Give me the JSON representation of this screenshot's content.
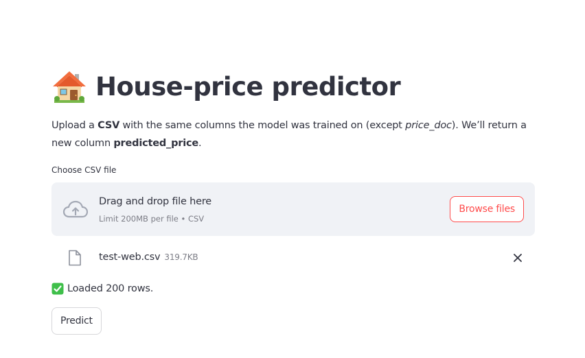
{
  "header": {
    "title": "House-price predictor",
    "icon": "house-icon"
  },
  "description": {
    "part1": "Upload a ",
    "bold1": "CSV",
    "part2": " with the same columns the model was trained on (except ",
    "italic1": "price_doc",
    "part3": "). We’ll return a new column ",
    "bold2": "predicted_price",
    "part4": "."
  },
  "uploader": {
    "label": "Choose CSV file",
    "drag_text": "Drag and drop file here",
    "limit_text": "Limit 200MB per file • CSV",
    "browse_label": "Browse files",
    "icon": "cloud-upload-icon"
  },
  "uploaded_file": {
    "name": "test-web.csv",
    "size": "319.7KB",
    "icon": "file-icon",
    "remove_icon": "close-icon"
  },
  "status": {
    "text": "Loaded 200 rows.",
    "icon": "check-icon"
  },
  "actions": {
    "predict_label": "Predict"
  },
  "colors": {
    "accent": "#ff4b4b",
    "text": "#31333f",
    "dropzone_bg": "#f0f2f6",
    "success": "#3fbf4a"
  }
}
